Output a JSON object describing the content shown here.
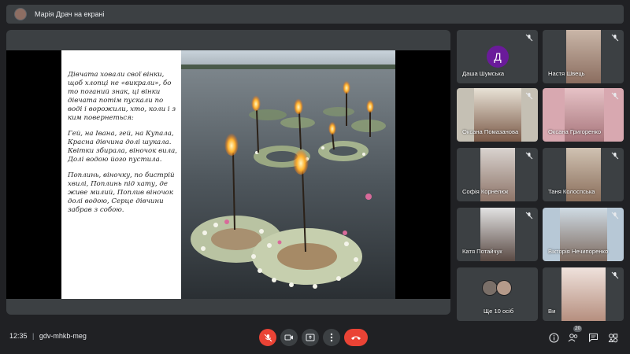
{
  "header": {
    "presenter_label": "Марія Драч на екрані"
  },
  "slide": {
    "paragraphs": [
      "Дівчата ховали свої вінки, щоб хлопці не «викрали», бо то поганий знак, ці вінки дівчата потім пускали по воді і ворожили, хто, коли і з ким повернеться:",
      "Гей, на Івана, гей, на Купала, Красна дівчина долі шукала. Квітки збирала, віночок вила, Долі водою його пустила.",
      "Поплинь, віночку, по бистрій хвилі, Поплинь під хату, де живе милий, Поплив віночок долі водою, Серце дівчини забрав з собою."
    ]
  },
  "participants": [
    {
      "name": "Даша Шумська",
      "initial": "Д",
      "avatar_color": "#6a1b9a"
    },
    {
      "name": "Настя Швець"
    },
    {
      "name": "Оксана Помазанова"
    },
    {
      "name": "Оксана Григоренко"
    },
    {
      "name": "Софія Корнелюк"
    },
    {
      "name": "Таня Колоспська"
    },
    {
      "name": "Катя Потайчук"
    },
    {
      "name": "Вікторія Нечипоренко"
    },
    {
      "name": "Ще 10 осіб"
    },
    {
      "name": "Ви"
    }
  ],
  "controls": {
    "time": "12:35",
    "separator": "|",
    "meeting_code": "gdv-mhkb-meg",
    "participants_count": "20",
    "end_call_color": "#ea4335"
  }
}
